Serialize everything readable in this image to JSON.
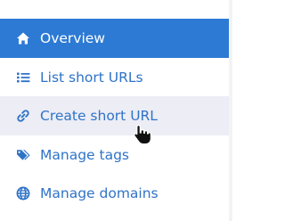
{
  "sidebar": {
    "items": [
      {
        "label": "Overview",
        "icon": "home-icon",
        "state": "active"
      },
      {
        "label": "List short URLs",
        "icon": "list-icon",
        "state": "normal"
      },
      {
        "label": "Create short URL",
        "icon": "link-icon",
        "state": "hover"
      },
      {
        "label": "Manage tags",
        "icon": "tags-icon",
        "state": "normal"
      },
      {
        "label": "Manage domains",
        "icon": "globe-icon",
        "state": "normal"
      }
    ]
  },
  "colors": {
    "accent": "#2d7ad4",
    "link_text": "#2f73c7",
    "hover_bg": "#ecedf5",
    "active_text": "#ffffff"
  },
  "cursor": {
    "icon": "hand-pointer-icon"
  }
}
